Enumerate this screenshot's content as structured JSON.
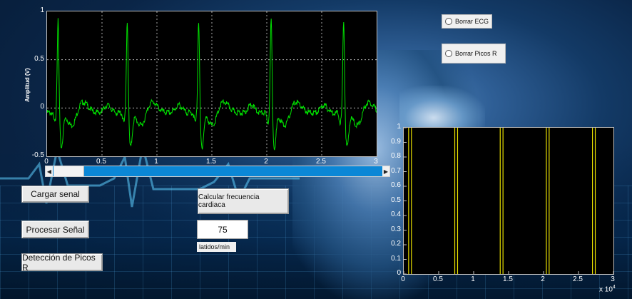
{
  "ecg_plot": {
    "ylabel": "Amplitud (V)",
    "y_ticks": [
      "1",
      "0.5",
      "0",
      "-0.5"
    ],
    "x_ticks": [
      "0",
      "0.5",
      "1",
      "1.5",
      "2",
      "2.5",
      "3"
    ],
    "line_color": "#00e000"
  },
  "peaks_plot": {
    "y_ticks": [
      "1",
      "0.9",
      "0.8",
      "0.7",
      "0.6",
      "0.5",
      "0.4",
      "0.3",
      "0.2",
      "0.1",
      "0"
    ],
    "x_ticks": [
      "0",
      "0.5",
      "1",
      "1.5",
      "2",
      "2.5",
      "3"
    ],
    "x_multiplier": "x 10",
    "x_multiplier_exp": "4",
    "line_color": "#e8e000"
  },
  "buttons": {
    "cargar": "Cargar senal",
    "procesar": "Procesar Señal",
    "deteccion": "Detección de Picos R",
    "calcular": "Calcular frecuencia cardiaca"
  },
  "radio": {
    "borrar_ecg": "Borrar ECG",
    "borrar_picos": "Borrar Picos R"
  },
  "heart_rate": {
    "value": "75",
    "unit_label": "latidos/min"
  },
  "scrollbar": {
    "left_arrow": "◀",
    "right_arrow": "▶"
  },
  "chart_data": [
    {
      "type": "line",
      "title": "",
      "xlabel": "",
      "ylabel": "Amplitud (V)",
      "xlim": [
        0,
        3
      ],
      "ylim": [
        -0.5,
        1
      ],
      "grid": true,
      "r_peaks_x": [
        0.1,
        0.73,
        1.38,
        2.04,
        2.7
      ]
    },
    {
      "type": "line",
      "title": "",
      "xlabel": "x 10^4",
      "ylabel": "",
      "xlim": [
        0,
        30000
      ],
      "ylim": [
        0,
        1
      ],
      "grid": false,
      "pulse_pairs_x": [
        [
          700,
          1100
        ],
        [
          7300,
          7700
        ],
        [
          13800,
          14200
        ],
        [
          20400,
          20800
        ],
        [
          27000,
          27400
        ]
      ]
    }
  ]
}
